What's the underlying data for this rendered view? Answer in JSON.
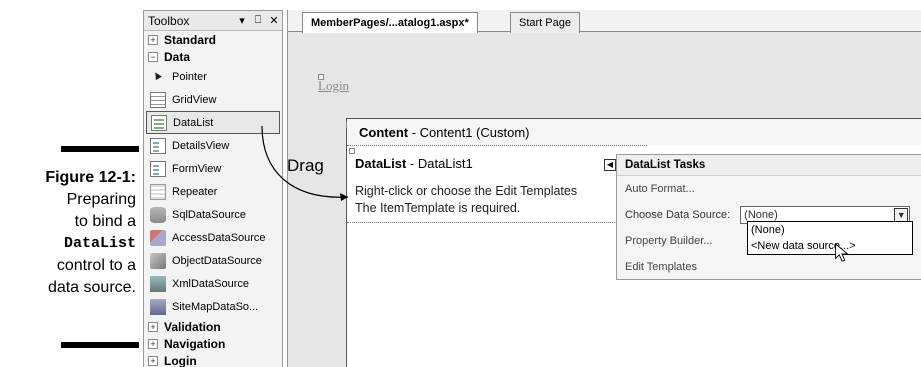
{
  "caption": {
    "figure_number": "Figure 12-1:",
    "lines": [
      "Preparing",
      "to bind a",
      "DataList",
      "control to a",
      "data source."
    ]
  },
  "toolbox": {
    "title": "Toolbox",
    "controls": [
      "▾",
      "⎕",
      "✕"
    ],
    "groups": {
      "standard": "Standard",
      "data": "Data",
      "validation": "Validation",
      "navigation": "Navigation",
      "login": "Login"
    },
    "items": [
      "Pointer",
      "GridView",
      "DataList",
      "DetailsView",
      "FormView",
      "Repeater",
      "SqlDataSource",
      "AccessDataSource",
      "ObjectDataSource",
      "XmlDataSource",
      "SiteMapDataSo..."
    ]
  },
  "tabs": {
    "active": "MemberPages/...atalog1.aspx*",
    "inactive": "Start Page"
  },
  "designer": {
    "login_link": "Login",
    "content_header_bold": "Content",
    "content_header_rest": " - Content1 (Custom)",
    "datalist_title_bold": "DataList",
    "datalist_title_rest": " - DataList1",
    "datalist_line1": "Right-click or choose the Edit Templates",
    "datalist_line2": "The ItemTemplate is required."
  },
  "tasks": {
    "title": "DataList Tasks",
    "auto_format": "Auto Format...",
    "choose_label": "Choose Data Source:",
    "choose_value": "(None)",
    "property_builder": "Property Builder...",
    "edit_templates": "Edit Templates",
    "dropdown_options": [
      "(None)",
      "<New data source...>"
    ]
  },
  "annotation": {
    "drag_label": "Drag"
  }
}
